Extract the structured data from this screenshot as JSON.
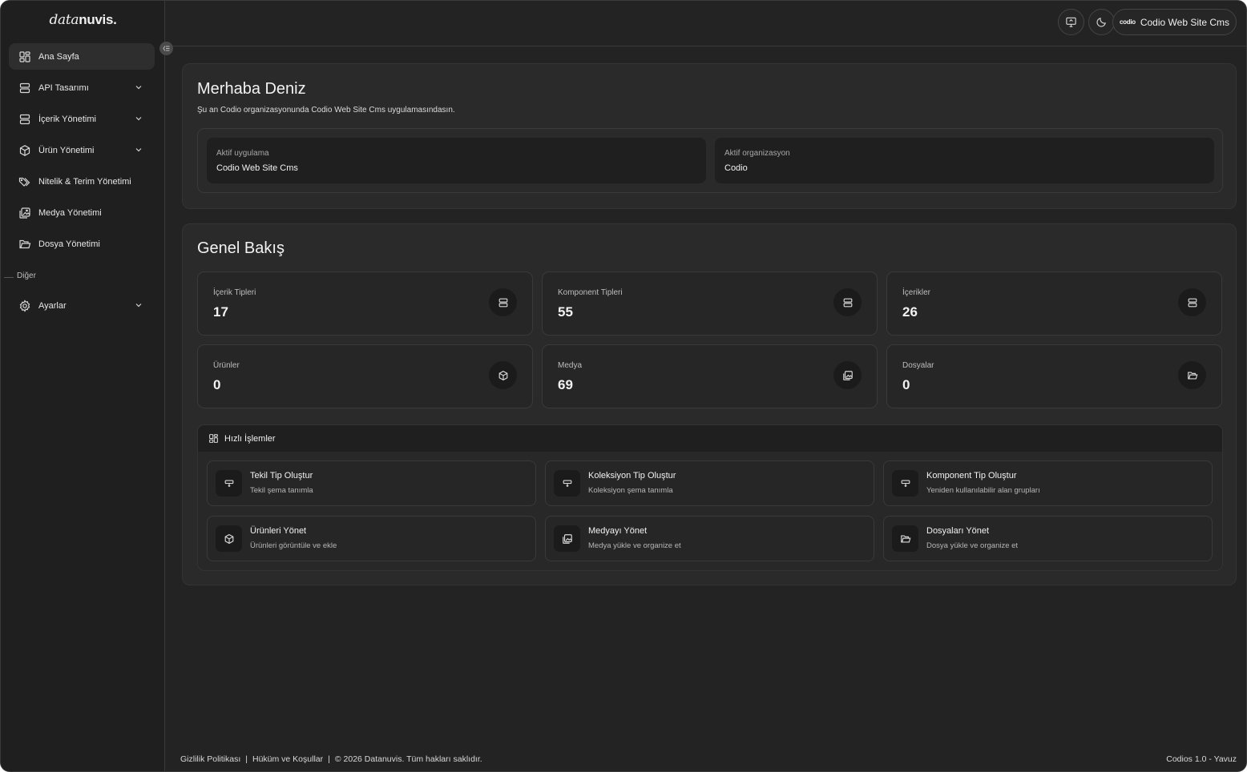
{
  "brand": {
    "part1": "data",
    "part2": "nuvis."
  },
  "sidebar": {
    "items": [
      {
        "label": "Ana Sayfa",
        "icon": "dashboard-icon",
        "active": true
      },
      {
        "label": "API Tasarımı",
        "icon": "database-icon",
        "chevron": true
      },
      {
        "label": "İçerik Yönetimi",
        "icon": "database-icon",
        "chevron": true
      },
      {
        "label": "Ürün Yönetimi",
        "icon": "package-icon",
        "chevron": true
      },
      {
        "label": "Nitelik & Terim Yönetimi",
        "icon": "tags-icon"
      },
      {
        "label": "Medya Yönetimi",
        "icon": "images-icon"
      },
      {
        "label": "Dosya Yönetimi",
        "icon": "folder-icon"
      }
    ],
    "section_label": "Diğer",
    "settings": {
      "label": "Ayarlar",
      "icon": "gear-icon"
    }
  },
  "topbar": {
    "app_brand": "codio",
    "app_name": "Codio Web Site Cms"
  },
  "welcome": {
    "title": "Merhaba Deniz",
    "subtitle": "Şu an Codio organizasyonunda Codio Web Site Cms uygulamasındasın.",
    "active_app_label": "Aktif uygulama",
    "active_app_value": "Codio Web Site Cms",
    "active_org_label": "Aktif organizasyon",
    "active_org_value": "Codio"
  },
  "overview": {
    "title": "Genel Bakış",
    "stats": [
      {
        "label": "İçerik Tipleri",
        "value": "17",
        "icon": "database-icon"
      },
      {
        "label": "Komponent Tipleri",
        "value": "55",
        "icon": "database-icon"
      },
      {
        "label": "İçerikler",
        "value": "26",
        "icon": "database-icon"
      },
      {
        "label": "Ürünler",
        "value": "0",
        "icon": "package-icon"
      },
      {
        "label": "Medya",
        "value": "69",
        "icon": "images-icon"
      },
      {
        "label": "Dosyalar",
        "value": "0",
        "icon": "folder-icon"
      }
    ]
  },
  "quick_actions": {
    "title": "Hızlı İşlemler",
    "items": [
      {
        "title": "Tekil Tip Oluştur",
        "desc": "Tekil şema tanımla",
        "icon": "schema-icon"
      },
      {
        "title": "Koleksiyon Tip Oluştur",
        "desc": "Koleksiyon şema tanımla",
        "icon": "schema-icon"
      },
      {
        "title": "Komponent Tip Oluştur",
        "desc": "Yeniden kullanılabilir alan grupları",
        "icon": "schema-icon"
      },
      {
        "title": "Ürünleri Yönet",
        "desc": "Ürünleri görüntüle ve ekle",
        "icon": "package-icon"
      },
      {
        "title": "Medyayı Yönet",
        "desc": "Medya yükle ve organize et",
        "icon": "images-icon"
      },
      {
        "title": "Dosyaları Yönet",
        "desc": "Dosya yükle ve organize et",
        "icon": "folder-icon"
      }
    ]
  },
  "footer": {
    "privacy": "Gizlilik Politikası",
    "terms": "Hüküm ve Koşullar",
    "copyright": "© 2026 Datanuvis. Tüm hakları saklıdır.",
    "version": "Codios 1.0 - Yavuz"
  }
}
